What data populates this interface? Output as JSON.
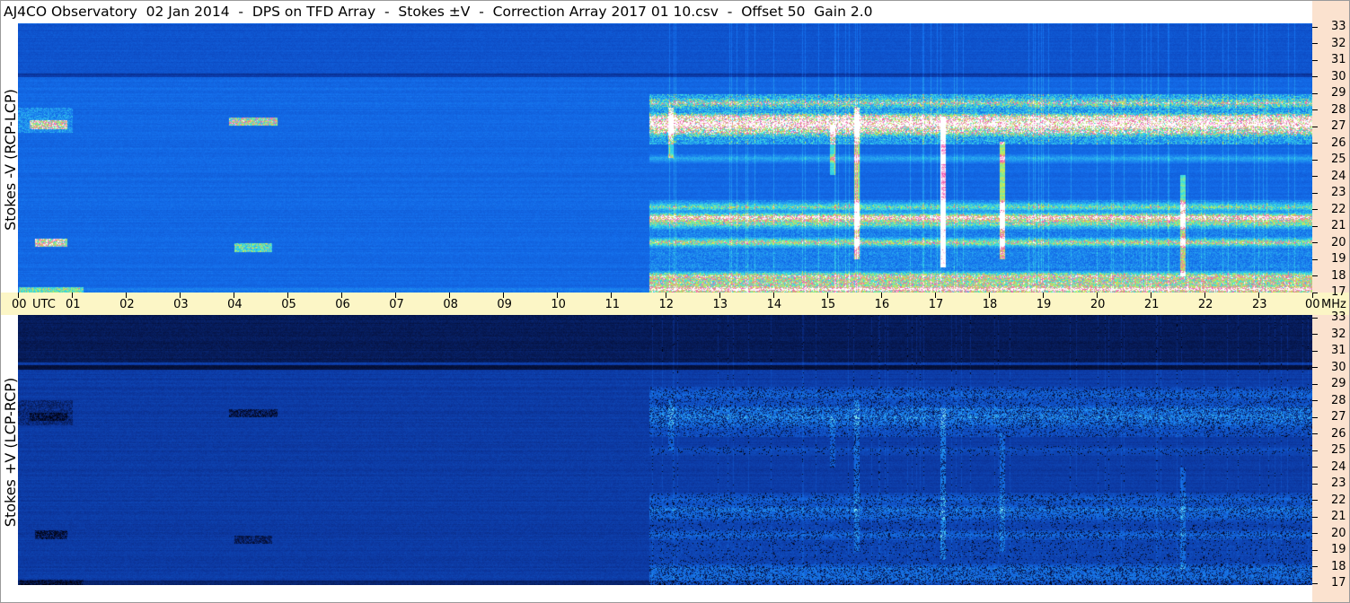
{
  "header": {
    "title": "AJ4CO Observatory  02 Jan 2014  -  DPS on TFD Array  -  Stokes ±V  -  Correction Array 2017 01 10.csv  -  Offset 50  Gain 2.0"
  },
  "chart_data": [
    {
      "type": "heatmap",
      "panel": "upper",
      "ylabel": "Stokes -V (RCP-LCP)",
      "x_ticks": [
        "00",
        "UTC",
        "01",
        "02",
        "03",
        "04",
        "05",
        "06",
        "07",
        "08",
        "09",
        "10",
        "11",
        "12",
        "13",
        "14",
        "15",
        "16",
        "17",
        "18",
        "19",
        "20",
        "21",
        "22",
        "23",
        "00"
      ],
      "x_range_hours": [
        0,
        24
      ],
      "y_ticks": [
        "17",
        "18",
        "19",
        "20",
        "21",
        "22",
        "23",
        "24",
        "25",
        "26",
        "27",
        "28",
        "29",
        "30",
        "31",
        "32",
        "33"
      ],
      "y_unit": "MHz",
      "y_range_mhz": [
        17,
        33
      ],
      "colormap": "dark blue to blue to cyan to yellow to magenta to white"
    },
    {
      "type": "heatmap",
      "panel": "lower",
      "ylabel": "Stokes +V (LCP-RCP)",
      "x_ticks": [
        "00",
        "UTC",
        "01",
        "02",
        "03",
        "04",
        "05",
        "06",
        "07",
        "08",
        "09",
        "10",
        "11",
        "12",
        "13",
        "14",
        "15",
        "16",
        "17",
        "18",
        "19",
        "20",
        "21",
        "22",
        "23",
        "00"
      ],
      "x_range_hours": [
        0,
        24
      ],
      "y_ticks": [
        "17",
        "18",
        "19",
        "20",
        "21",
        "22",
        "23",
        "24",
        "25",
        "26",
        "27",
        "28",
        "29",
        "30",
        "31",
        "32",
        "33"
      ],
      "y_unit": "MHz",
      "y_range_mhz": [
        17,
        33
      ],
      "colormap": "black to dark blue to blue to cyan"
    }
  ],
  "axis": {
    "hours": [
      "01",
      "02",
      "03",
      "04",
      "05",
      "06",
      "07",
      "08",
      "09",
      "10",
      "11",
      "12",
      "13",
      "14",
      "15",
      "16",
      "17",
      "18",
      "19",
      "20",
      "21",
      "22",
      "23"
    ],
    "start_label": "00",
    "utc_label": "UTC",
    "end_label": "00",
    "mhz_label": "MHz",
    "freqs": [
      "17",
      "18",
      "19",
      "20",
      "21",
      "22",
      "23",
      "24",
      "25",
      "26",
      "27",
      "28",
      "29",
      "30",
      "31",
      "32",
      "33"
    ]
  },
  "colors": {
    "time_axis_bg": "#fcf6c6",
    "freq_axis_bg": "#fbe2cf"
  }
}
